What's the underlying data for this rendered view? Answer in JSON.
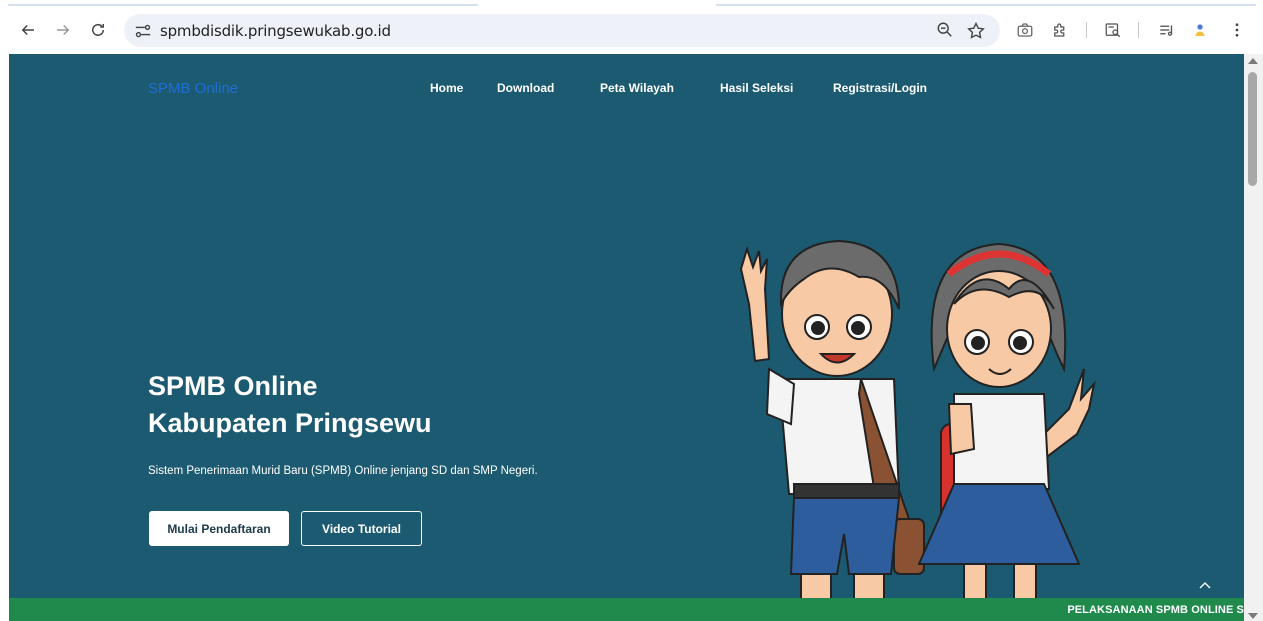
{
  "browser": {
    "url": "spmbdisdik.pringsewukab.go.id",
    "icons": [
      "back-icon",
      "forward-icon",
      "reload-icon",
      "site-info-icon",
      "zoom-icon",
      "bookmark-star-icon",
      "camera-icon",
      "extensions-icon",
      "reading-mode-icon",
      "media-control-icon",
      "profile-icon",
      "kebab-menu-icon"
    ]
  },
  "site": {
    "brand": "SPMB Online",
    "nav": [
      "Home",
      "Download",
      "Peta Wilayah",
      "Hasil Seleksi",
      "Registrasi/Login"
    ]
  },
  "hero": {
    "title_line1": "SPMB Online",
    "title_line2": "Kabupaten Pringsewu",
    "subtitle": "Sistem Penerimaan Murid Baru (SPMB) Online jenjang SD dan SMP Negeri.",
    "primary_button": "Mulai Pendaftaran",
    "secondary_button": "Video Tutorial"
  },
  "ticker": {
    "text": "PELAKSANAAN SPMB ONLINE S"
  },
  "colors": {
    "hero_bg": "#1b5a70",
    "brand_link": "#1e6fd6",
    "ticker_bg": "#1f8a4c"
  }
}
